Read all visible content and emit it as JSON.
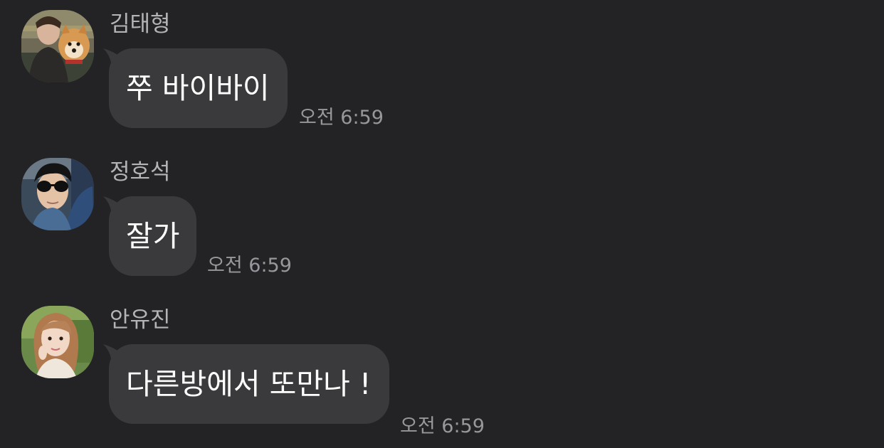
{
  "colors": {
    "background": "#232325",
    "bubble": "#3a3a3c",
    "message_text": "#ffffff",
    "sender_text": "#b4b4b8",
    "time_text": "#98989c"
  },
  "messages": [
    {
      "sender": "김태형",
      "avatar_icon": "avatar-photo-man-with-dog",
      "text": "쭈 바이바이",
      "time": "오전 6:59"
    },
    {
      "sender": "정호석",
      "avatar_icon": "avatar-photo-man-sunglasses",
      "text": "잘가",
      "time": "오전 6:59"
    },
    {
      "sender": "안유진",
      "avatar_icon": "avatar-photo-woman",
      "text": "다른방에서 또만나 !",
      "time": "오전 6:59"
    }
  ]
}
